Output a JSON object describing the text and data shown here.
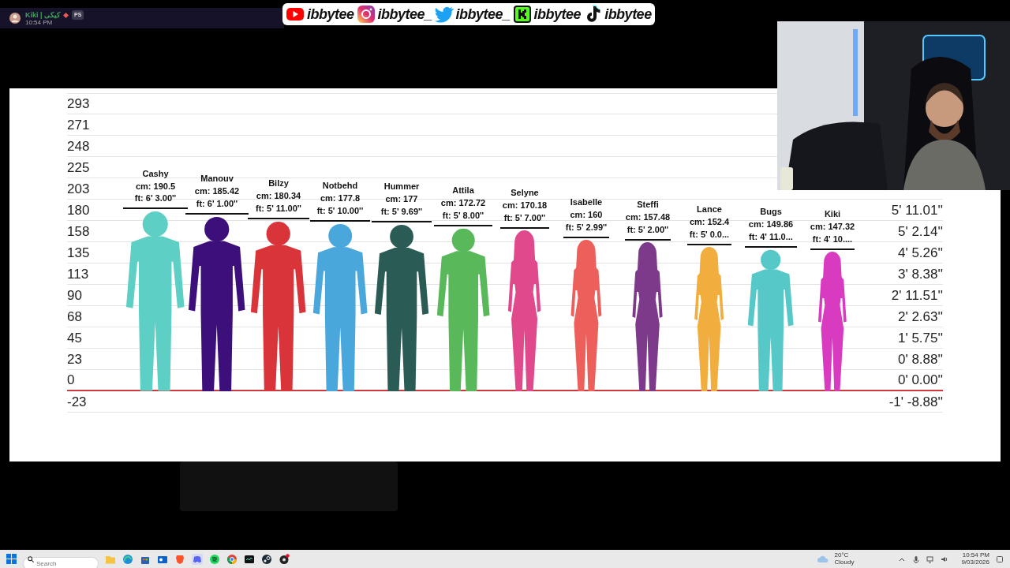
{
  "notification": {
    "name": "Kiki | کیکی",
    "badge": "PS",
    "time": "10:54 PM"
  },
  "socials": [
    {
      "kind": "youtube",
      "handle": "ibbytee"
    },
    {
      "kind": "instagram",
      "handle": "ibbytee_"
    },
    {
      "kind": "twitter",
      "handle": "ibbytee_"
    },
    {
      "kind": "kick",
      "handle": "ibbytee"
    },
    {
      "kind": "tiktok",
      "handle": "ibbytee"
    }
  ],
  "chart": {
    "rows": [
      {
        "cm": "293",
        "baseline": false
      },
      {
        "cm": "271",
        "baseline": false
      },
      {
        "cm": "248",
        "baseline": false
      },
      {
        "cm": "225",
        "baseline": false
      },
      {
        "cm": "203",
        "baseline": false
      },
      {
        "cm": "180",
        "ft": "5' 11.01''",
        "baseline": false
      },
      {
        "cm": "158",
        "ft": "5' 2.14''",
        "baseline": false
      },
      {
        "cm": "135",
        "ft": "4' 5.26''",
        "baseline": false
      },
      {
        "cm": "113",
        "ft": "3' 8.38''",
        "baseline": false
      },
      {
        "cm": "90",
        "ft": "2' 11.51''",
        "baseline": false
      },
      {
        "cm": "68",
        "ft": "2' 2.63''",
        "baseline": false
      },
      {
        "cm": "45",
        "ft": "1' 5.75''",
        "baseline": false
      },
      {
        "cm": "23",
        "ft": "0' 8.88''",
        "baseline": false
      },
      {
        "cm": "0",
        "ft": "0' 0.00''",
        "baseline": true
      },
      {
        "cm": "-23",
        "ft": "-1' -8.88''",
        "baseline": false
      }
    ],
    "people": [
      {
        "name": "Cashy",
        "cm": "cm: 190.5",
        "ft": "ft: 6' 3.00''",
        "color": "#5ecfc4",
        "kind": "male"
      },
      {
        "name": "Manouv",
        "cm": "cm: 185.42",
        "ft": "ft: 6' 1.00''",
        "color": "#3d0f7a",
        "kind": "male"
      },
      {
        "name": "Bilzy",
        "cm": "cm: 180.34",
        "ft": "ft: 5' 11.00''",
        "color": "#d9343a",
        "kind": "male"
      },
      {
        "name": "Notbehd",
        "cm": "cm: 177.8",
        "ft": "ft: 5' 10.00''",
        "color": "#4aa7dc",
        "kind": "male"
      },
      {
        "name": "Hummer",
        "cm": "cm: 177",
        "ft": "ft: 5' 9.69''",
        "color": "#2b5b55",
        "kind": "male"
      },
      {
        "name": "Attila",
        "cm": "cm: 172.72",
        "ft": "ft: 5' 8.00''",
        "color": "#59b85a",
        "kind": "male"
      },
      {
        "name": "Selyne",
        "cm": "cm: 170.18",
        "ft": "ft: 5' 7.00''",
        "color": "#e0498c",
        "kind": "female"
      },
      {
        "name": "Isabelle",
        "cm": "cm: 160",
        "ft": "ft: 5' 2.99''",
        "color": "#ec5f5a",
        "kind": "female"
      },
      {
        "name": "Steffi",
        "cm": "cm: 157.48",
        "ft": "ft: 5' 2.00''",
        "color": "#7d3a8a",
        "kind": "female"
      },
      {
        "name": "Lance",
        "cm": "cm: 152.4",
        "ft": "ft: 5' 0.0...",
        "color": "#f1ad3d",
        "kind": "female"
      },
      {
        "name": "Bugs",
        "cm": "cm: 149.86",
        "ft": "ft: 4' 11.0...",
        "color": "#56c8c8",
        "kind": "male"
      },
      {
        "name": "Kiki",
        "cm": "cm: 147.32",
        "ft": "ft: 4' 10....",
        "color": "#d93bc0",
        "kind": "female"
      }
    ]
  },
  "taskbar": {
    "search": {
      "placeholder": "Search"
    },
    "apps": [
      {
        "kind": "folder"
      },
      {
        "kind": "globe"
      },
      {
        "kind": "store"
      },
      {
        "kind": "mail"
      },
      {
        "kind": "shield"
      },
      {
        "kind": "chat"
      },
      {
        "kind": "music"
      },
      {
        "kind": "circle"
      },
      {
        "kind": "terminal"
      },
      {
        "kind": "steam"
      },
      {
        "kind": "record"
      }
    ],
    "weather": {
      "temp": "20°C",
      "condition": "Cloudy"
    },
    "tray": [
      {
        "kind": "caret"
      },
      {
        "kind": "mic"
      },
      {
        "kind": "display"
      },
      {
        "kind": "volume"
      }
    ],
    "time": "10:54 PM",
    "date": "9/03/2026"
  }
}
